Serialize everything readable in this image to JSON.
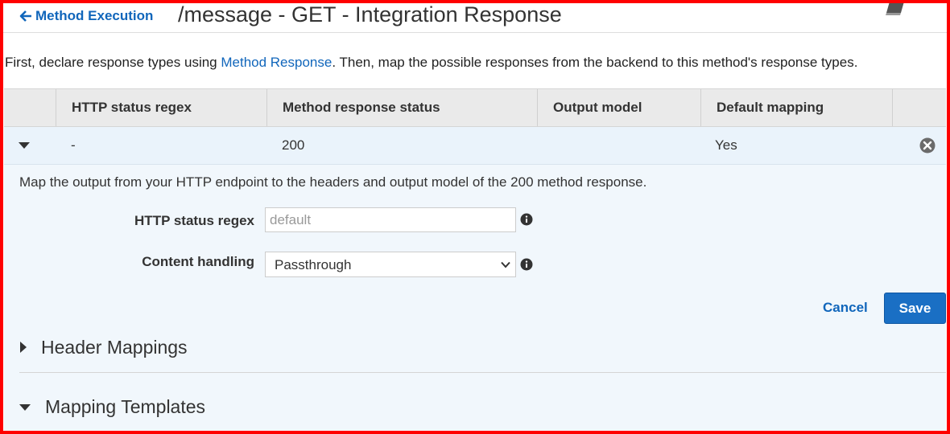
{
  "header": {
    "back_label": "Method Execution",
    "title": "/message - GET - Integration Response",
    "help_icon": "book-icon"
  },
  "intro": {
    "before": "First, declare response types using ",
    "link": "Method Response",
    "after": ". Then, map the possible responses from the backend to this method's response types."
  },
  "table": {
    "columns": [
      "HTTP status regex",
      "Method response status",
      "Output model",
      "Default mapping"
    ],
    "rows": [
      {
        "regex": "-",
        "status": "200",
        "output_model": "",
        "default_mapping": "Yes"
      }
    ]
  },
  "panel": {
    "description": "Map the output from your HTTP endpoint to the headers and output model of the 200 method response.",
    "regex_label": "HTTP status regex",
    "regex_value": "",
    "regex_placeholder": "default",
    "content_label": "Content handling",
    "content_value": "Passthrough",
    "cancel_label": "Cancel",
    "save_label": "Save"
  },
  "sections": {
    "header_mappings": "Header Mappings",
    "mapping_templates": "Mapping Templates"
  },
  "colors": {
    "link": "#1166bb",
    "primary_button": "#1a6fc4",
    "row_highlight": "#eaf3fb",
    "frame": "#ff0000"
  }
}
